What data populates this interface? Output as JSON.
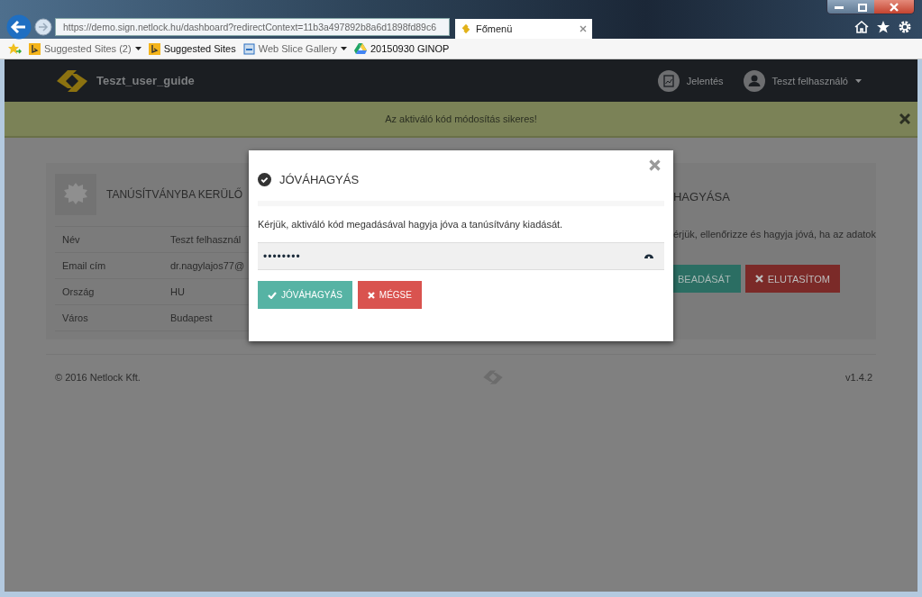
{
  "browser": {
    "address": "https://demo.sign.netlock.hu/dashboard?redirectContext=11b3a497892b8a6d1898fd89c6",
    "tab": {
      "title": "Főmenü",
      "selected": true
    },
    "favorites": [
      {
        "label": "Suggested Sites (2)",
        "kind": "bing",
        "dropdown": true
      },
      {
        "label": "Suggested Sites",
        "kind": "bing",
        "dropdown": false
      },
      {
        "label": "Web Slice Gallery",
        "kind": "slice",
        "dropdown": true
      },
      {
        "label": "20150930 GINOP",
        "kind": "drive",
        "dropdown": false
      }
    ]
  },
  "navbar": {
    "brand": "Teszt_user_guide",
    "report": "Jelentés",
    "user": "Teszt felhasználó"
  },
  "alert": {
    "message": "Az aktiváló kód módosítás sikeres!"
  },
  "left_card": {
    "title": "TANÚSÍTVÁNYBA KERÜLŐ",
    "rows": [
      {
        "label": "Név",
        "value": "Teszt felhasznál"
      },
      {
        "label": "Email cím",
        "value": "dr.nagylajos77@"
      },
      {
        "label": "Ország",
        "value": "HU"
      },
      {
        "label": "Város",
        "value": "Budapest"
      }
    ]
  },
  "right_card": {
    "title": "HAGYÁSA",
    "text": "érjük, ellenőrizze és hagyja jóvá, ha az adatok",
    "buttons": [
      {
        "label": "BEADÁSÁT",
        "kind": "approve"
      },
      {
        "label": "ELUTASÍTOM",
        "kind": "reject"
      }
    ]
  },
  "footer": {
    "copyright": "© 2016 Netlock Kft.",
    "version": "v1.4.2"
  },
  "modal": {
    "title": "JÓVÁHAGYÁS",
    "text": "Kérjük, aktiváló kód megadásával hagyja jóva a tanúsítvány kiadását.",
    "password": "••••••••",
    "buttons": [
      {
        "label": "JÓVÁHAGYÁS",
        "kind": "approve"
      },
      {
        "label": "MÉGSE",
        "kind": "cancel"
      }
    ]
  }
}
